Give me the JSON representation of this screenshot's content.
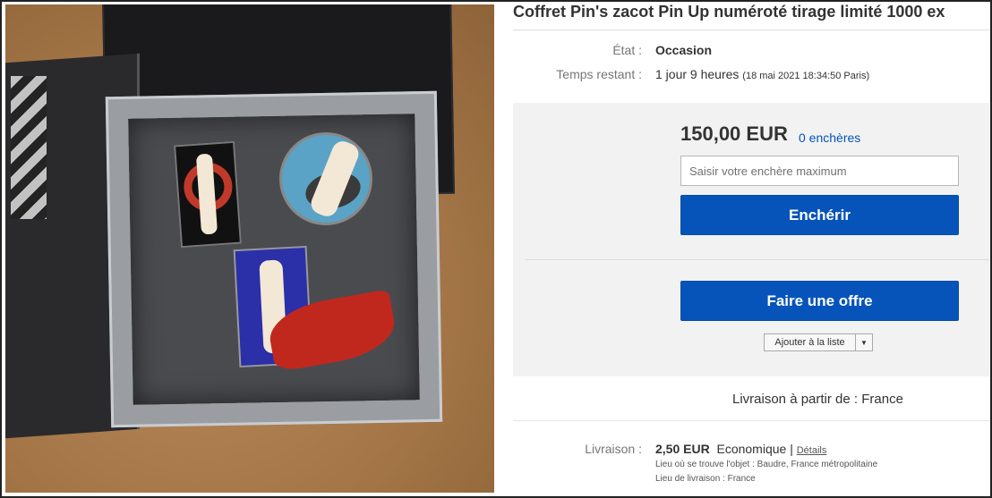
{
  "listing": {
    "title": "Coffret Pin's zacot Pin Up numéroté tirage limité 1000 ex",
    "state_label": "État :",
    "state_value": "Occasion",
    "time_label": "Temps restant :",
    "time_value": "1 jour 9 heures",
    "time_detail": "(18 mai 2021  18:34:50 Paris)"
  },
  "bid": {
    "price": "150,00 EUR",
    "bids_count": "0 enchères",
    "input_placeholder": "Saisir votre enchère maximum",
    "bid_button": "Enchérir",
    "offer_button": "Faire une offre",
    "watchlist_button": "Ajouter à la liste"
  },
  "delivery": {
    "from_text": "Livraison à partir de : France",
    "shipping_label": "Livraison :",
    "shipping_price": "2,50 EUR",
    "shipping_method": "Economique |",
    "details_link": "Détails",
    "item_location": "Lieu où se trouve l'objet :  Baudre, France métropolitaine",
    "ships_to": "Lieu de livraison :  France"
  },
  "colors": {
    "accent": "#0654ba",
    "panel_bg": "#f2f2f2"
  }
}
